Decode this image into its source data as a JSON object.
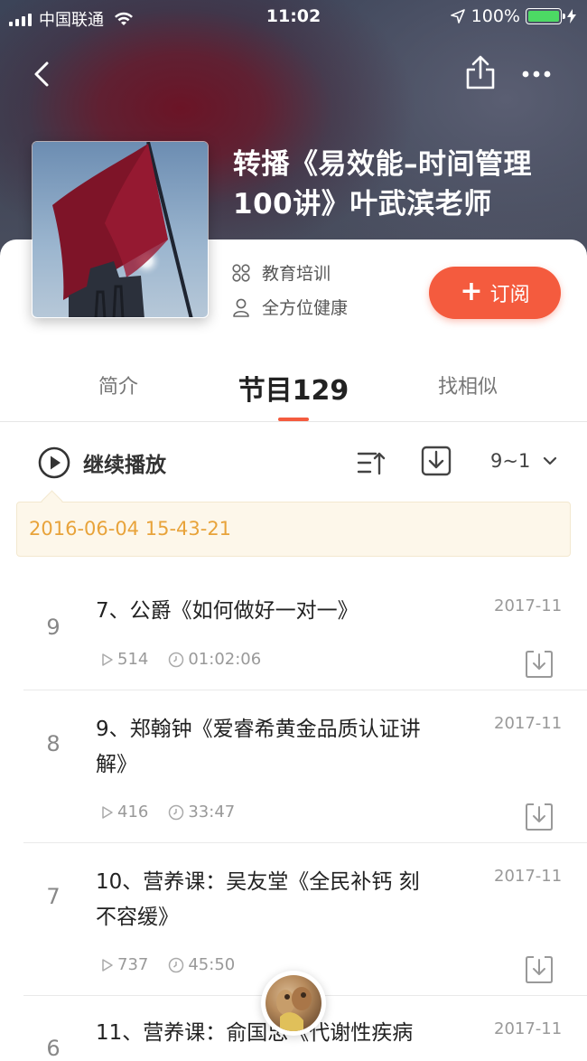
{
  "status_bar": {
    "carrier": "中国联通",
    "time": "11:02",
    "battery": "100%"
  },
  "album": {
    "title": "转播《易效能–时间管理100讲》叶武滨老师",
    "category": "教育培训",
    "author": "全方位健康",
    "subscribe_label": "订阅"
  },
  "tabs": [
    {
      "label": "简介"
    },
    {
      "label": "节目129"
    },
    {
      "label": "找相似"
    }
  ],
  "controls": {
    "continue_label": "继续播放",
    "range_label": "9~1"
  },
  "last_played": "2016-06-04 15-43-21",
  "episodes": [
    {
      "number": "9",
      "title": "7、公爵《如何做好一对一》",
      "date": "2017-11",
      "plays": "514",
      "duration": "01:02:06"
    },
    {
      "number": "8",
      "title": "9、郑翰钟《爱睿希黄金品质认证讲解》",
      "date": "2017-11",
      "plays": "416",
      "duration": "33:47"
    },
    {
      "number": "7",
      "title": "10、营养课：吴友堂《全民补钙 刻不容缓》",
      "date": "2017-11",
      "plays": "737",
      "duration": "45:50"
    },
    {
      "number": "6",
      "title": "11、营养课：俞国忠《代谢性疾病",
      "date": "2017-11",
      "plays": "",
      "duration": ""
    }
  ],
  "colors": {
    "accent": "#f45b3e",
    "tip_text": "#e8a33a",
    "tip_bg": "#fdf7ea"
  }
}
